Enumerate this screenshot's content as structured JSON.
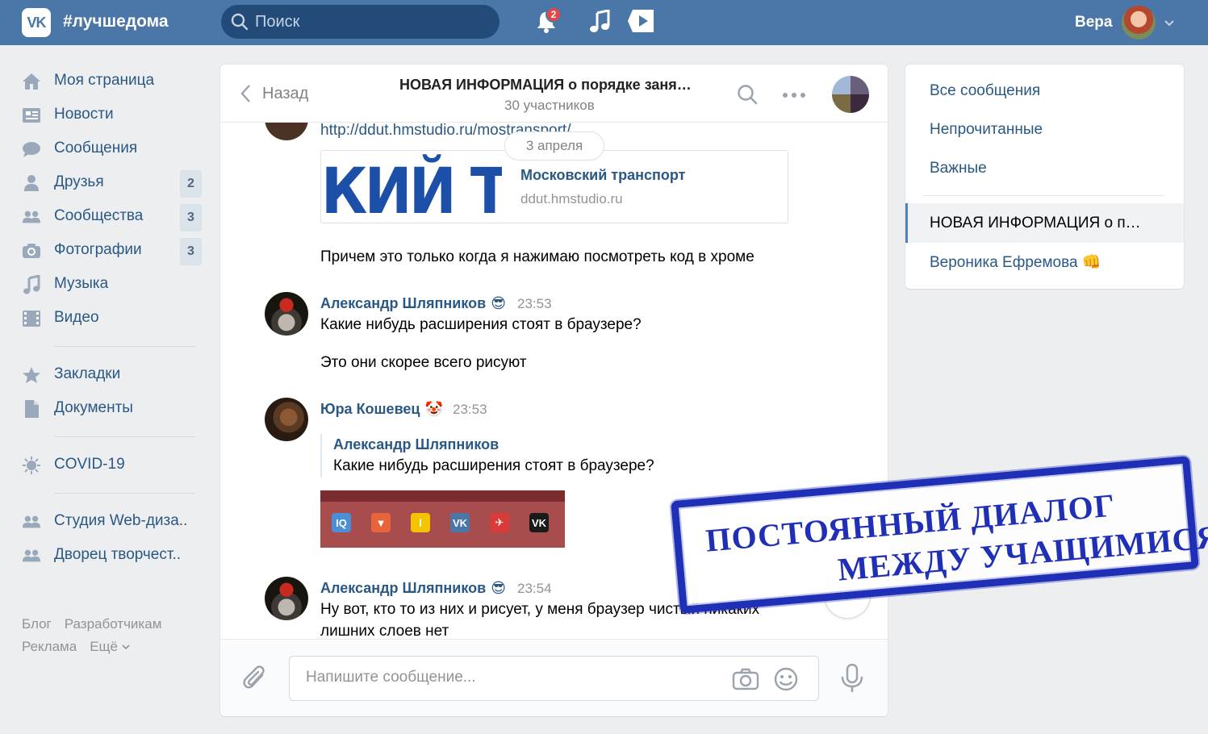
{
  "header": {
    "brand": "#лучшедома",
    "search_placeholder": "Поиск",
    "notifications_count": "2",
    "user_name": "Вера",
    "logo_text": "VK"
  },
  "nav": {
    "items": [
      {
        "label": "Моя страница",
        "icon": "home-icon"
      },
      {
        "label": "Новости",
        "icon": "news-icon"
      },
      {
        "label": "Сообщения",
        "icon": "messages-icon"
      },
      {
        "label": "Друзья",
        "icon": "friends-icon",
        "count": "2"
      },
      {
        "label": "Сообщества",
        "icon": "communities-icon",
        "count": "3"
      },
      {
        "label": "Фотографии",
        "icon": "camera-icon",
        "count": "3"
      },
      {
        "label": "Музыка",
        "icon": "music-icon"
      },
      {
        "label": "Видео",
        "icon": "video-icon"
      }
    ],
    "items2": [
      {
        "label": "Закладки",
        "icon": "star-icon"
      },
      {
        "label": "Документы",
        "icon": "document-icon"
      }
    ],
    "covid": "COVID-19",
    "groups": [
      {
        "label": "Студия Web-диза.."
      },
      {
        "label": "Дворец творчест.."
      }
    ],
    "footer": [
      "Блог",
      "Разработчикам",
      "Реклама",
      "Ещё"
    ]
  },
  "chat": {
    "back_label": "Назад",
    "title": "НОВАЯ ИНФОРМАЦИЯ  о порядке заня…",
    "subtitle": "30 участников",
    "date_pill": "3 апреля",
    "link_url": "http://ddut.hmstudio.ru/mostransport/",
    "link_thumb_text": "КИЙ ТІ",
    "link_title": "Московский транспорт",
    "link_domain": "ddut.hmstudio.ru",
    "msg0_text": "Причем это только когда я нажимаю посмотреть код в хроме",
    "messages": [
      {
        "author": "Александр Шляпников",
        "emoji": "😎",
        "time": "23:53",
        "lines": [
          "Какие нибудь расширения стоят в браузере?",
          "Это они скорее всего рисуют"
        ]
      },
      {
        "author": "Юра Кошевец",
        "emoji": "🤡",
        "time": "23:53",
        "quote_author": "Александр Шляпников",
        "quote_text": "Какие нибудь расширения стоят в браузере?"
      },
      {
        "author": "Александр Шляпников",
        "emoji": "😎",
        "time": "23:54",
        "lines": [
          "Ну вот, кто то из них и рисует, у меня браузер чистый никаких",
          "лишних слоев нет"
        ]
      }
    ],
    "extensions": [
      {
        "name": "iq-extension-icon",
        "glyph": "IQ",
        "color": "#4a8fd8"
      },
      {
        "name": "brave-extension-icon",
        "glyph": "▼",
        "color": "#e8643a"
      },
      {
        "name": "lastpass-extension-icon",
        "glyph": "l",
        "color": "#f5c400"
      },
      {
        "name": "vk-extension-icon",
        "glyph": "VK",
        "color": "#4a76a8"
      },
      {
        "name": "pin-extension-icon",
        "glyph": "✈",
        "color": "#d93a3a"
      },
      {
        "name": "vk-dark-extension-icon",
        "glyph": "VK",
        "color": "#1a1a1a"
      }
    ],
    "composer_placeholder": "Напишите сообщение..."
  },
  "right_panel": {
    "items": [
      "Все сообщения",
      "Непрочитанные",
      "Важные"
    ],
    "active": "НОВАЯ ИНФОРМАЦИЯ  о п…",
    "contact": "Вероника Ефремова",
    "contact_emoji": "👊"
  },
  "stamp": {
    "line1": "ПОСТОЯННЫЙ ДИАЛОГ",
    "line2": "МЕЖДУ УЧАЩИМИСЯ"
  },
  "colors": {
    "header": "#4a76a8",
    "link": "#2a5885",
    "stamp": "#1f2fb6"
  }
}
